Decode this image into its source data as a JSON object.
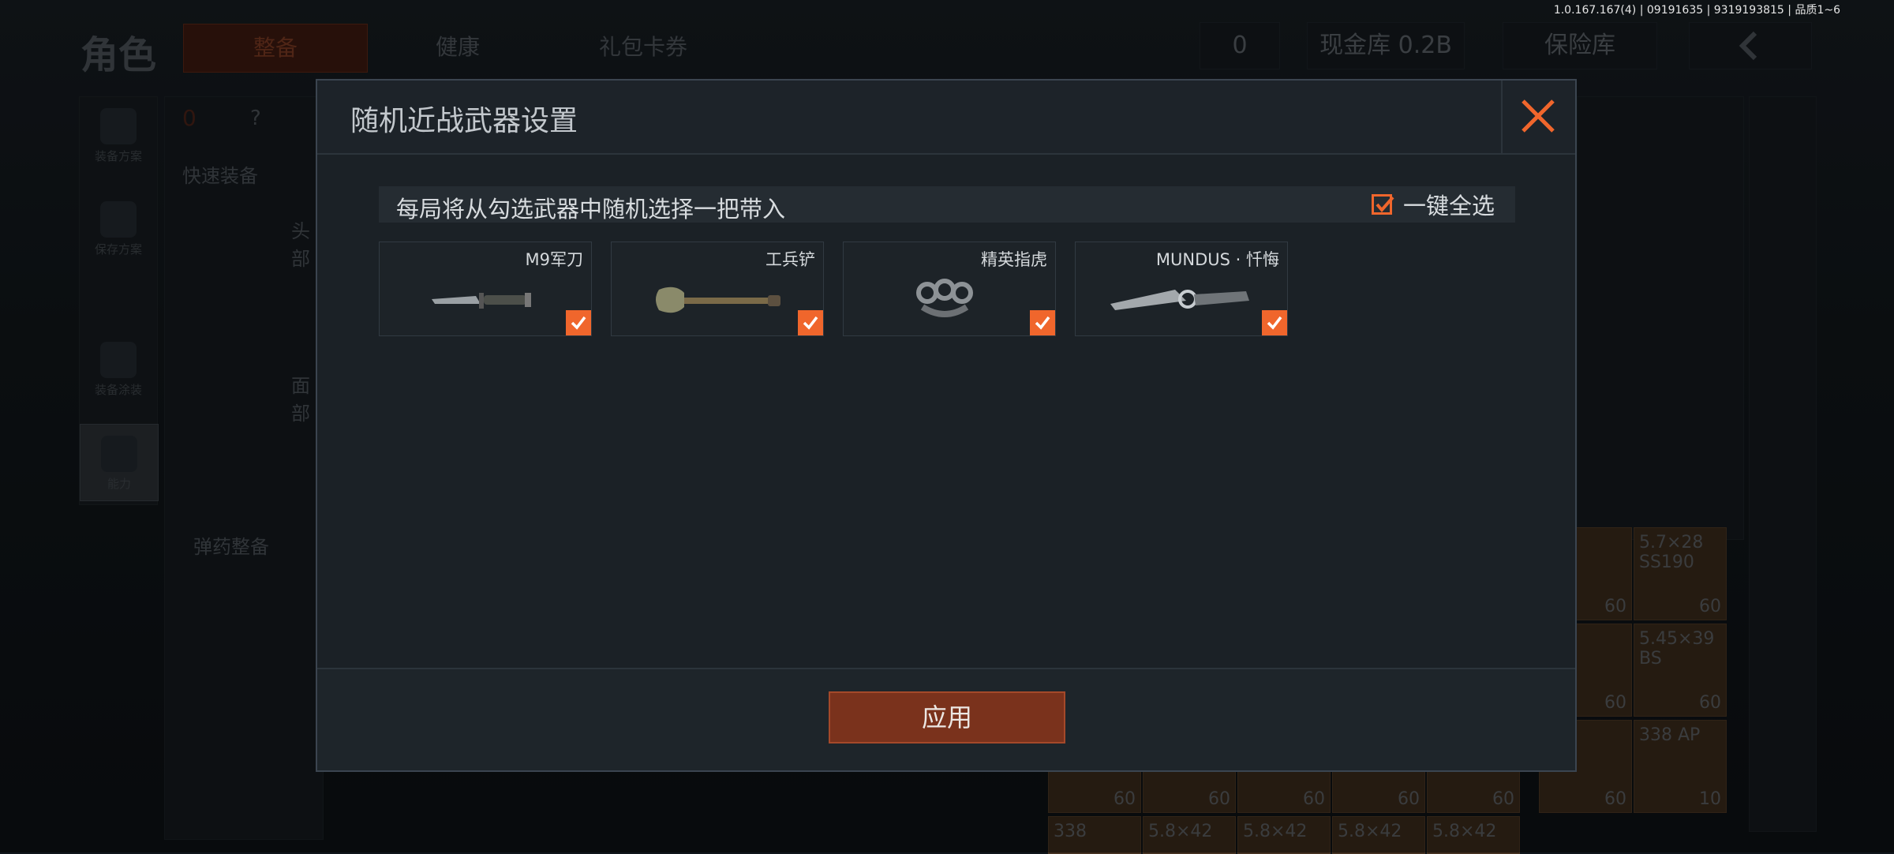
{
  "version_text": "1.0.167.167(4) | 09191635 | 9319193815 | 品质1~6",
  "background": {
    "title": "角色",
    "tabs": [
      "整备",
      "健康",
      "礼包卡券"
    ],
    "currency": "0",
    "cash_vault": "现金库 0.2B",
    "safe_box": "保险库",
    "rail": [
      "装备方案",
      "保存方案",
      "装备涂装",
      "能力"
    ],
    "red_count": "0",
    "help": "?",
    "quick_equip": "快速装备",
    "ammo_equip": "弹药整备",
    "slot_head": "头部",
    "slot_face": "面部",
    "ammo": [
      {
        "label": "5.7×28 SS190",
        "count": "60"
      },
      {
        "label": "5.45×39 BS",
        "count": "60"
      },
      {
        "label": "338 AP",
        "count": "10"
      }
    ],
    "ammo_row": [
      "60",
      "60",
      "60",
      "60",
      "60",
      "60"
    ],
    "ammo_bottom": [
      "338",
      "5.8×42",
      "5.8×42",
      "5.8×42",
      "5.8×42"
    ]
  },
  "modal": {
    "title": "随机近战武器设置",
    "info": "每局将从勾选武器中随机选择一把带入",
    "select_all": "一键全选",
    "select_all_checked": true,
    "weapons": [
      {
        "name": "M9军刀",
        "checked": true,
        "icon": "bayonet-knife"
      },
      {
        "name": "工兵铲",
        "checked": true,
        "icon": "shovel"
      },
      {
        "name": "精英指虎",
        "checked": true,
        "icon": "brass-knuckles"
      },
      {
        "name": "MUNDUS · 忏悔",
        "checked": true,
        "icon": "ornate-knife"
      }
    ],
    "apply": "应用"
  },
  "colors": {
    "accent": "#f0662c",
    "apply_bg": "#7a321c",
    "panel": "#1b2126"
  }
}
